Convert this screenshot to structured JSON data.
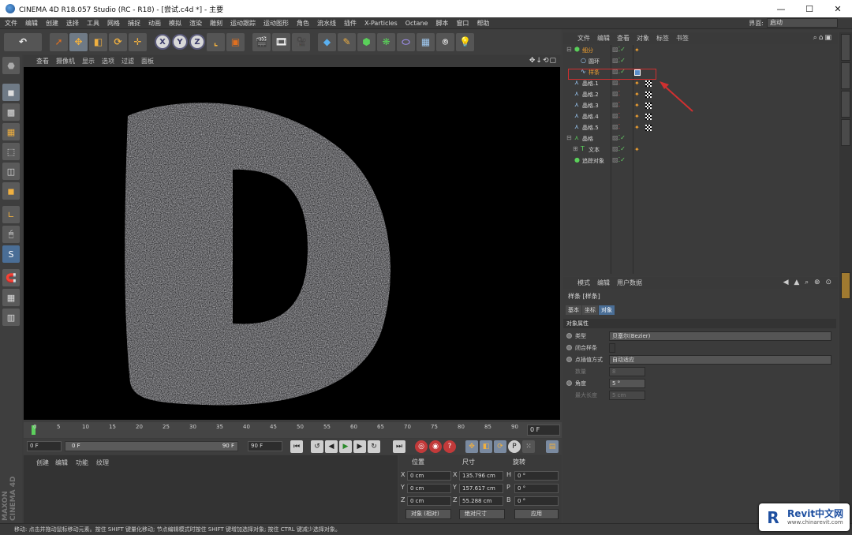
{
  "window": {
    "title": "CINEMA 4D R18.057 Studio (RC - R18) - [尝试.c4d *] - 主要",
    "min": "—",
    "max": "☐",
    "close": "✕"
  },
  "menu": {
    "items": [
      "文件",
      "编辑",
      "创建",
      "选择",
      "工具",
      "网格",
      "捕捉",
      "动画",
      "模拟",
      "渲染",
      "雕刻",
      "运动跟踪",
      "运动图形",
      "角色",
      "流水线",
      "插件",
      "X-Particles",
      "Octane",
      "脚本",
      "窗口",
      "帮助"
    ],
    "interface_label": "界面:",
    "interface_value": "启动"
  },
  "toolbar": {
    "undo": "↶",
    "axis": [
      "X",
      "Y",
      "Z"
    ]
  },
  "viewport": {
    "menu": [
      "查看",
      "摄像机",
      "显示",
      "选项",
      "过滤",
      "面板"
    ],
    "controls": "✥↓⟲▢"
  },
  "timeline": {
    "ticks": [
      "0",
      "5",
      "10",
      "15",
      "20",
      "25",
      "30",
      "35",
      "40",
      "45",
      "50",
      "55",
      "60",
      "65",
      "70",
      "75",
      "80",
      "85",
      "90"
    ],
    "frame_field": "0 F"
  },
  "transport": {
    "start": "0 F",
    "slider_start": "0 F",
    "slider_end": "90 F",
    "end": "90 F"
  },
  "material": {
    "menu": [
      "创建",
      "编辑",
      "功能",
      "纹理"
    ]
  },
  "coords": {
    "headers": [
      "位置",
      "尺寸",
      "旋转"
    ],
    "rows": [
      {
        "axis": "X",
        "pos": "0 cm",
        "size": "135.796 cm",
        "rlab": "H",
        "rot": "0 °"
      },
      {
        "axis": "Y",
        "pos": "0 cm",
        "size": "157.617 cm",
        "rlab": "P",
        "rot": "0 °"
      },
      {
        "axis": "Z",
        "pos": "0 cm",
        "size": "55.288 cm",
        "rlab": "B",
        "rot": "0 °"
      }
    ],
    "mode": "对象 (相对)",
    "size_mode": "绝对尺寸",
    "apply": "应用"
  },
  "status": "移动: 点击并拖动鼠标移动元素。按住 SHIFT 键量化移动; 节点编辑模式时按住 SHIFT 键增加选择对象; 按住 CTRL 键减少选择对象。",
  "maxon": "MAXON CINEMA 4D",
  "object_manager": {
    "menu": [
      "文件",
      "编辑",
      "查看",
      "对象",
      "标签",
      "书签"
    ],
    "objects": [
      {
        "name": "细分",
        "highlight": true
      },
      {
        "name": "圆环"
      },
      {
        "name": "样条",
        "highlight": true
      },
      {
        "name": "晶格.1"
      },
      {
        "name": "晶格.2"
      },
      {
        "name": "晶格.3"
      },
      {
        "name": "晶格.4"
      },
      {
        "name": "晶格.5"
      },
      {
        "name": "晶格"
      },
      {
        "name": "文本"
      },
      {
        "name": "追踪对象"
      }
    ]
  },
  "attributes": {
    "menu": [
      "模式",
      "编辑",
      "用户数据"
    ],
    "title": "样条 [样条]",
    "tabs": [
      "基本",
      "坐标",
      "对象"
    ],
    "section": "对象属性",
    "rows": [
      {
        "label": "类型",
        "value": "贝塞尔(Bezier)"
      },
      {
        "label": "闭合样条",
        "value": ""
      },
      {
        "label": "点插值方式",
        "value": "自动适应"
      },
      {
        "label": "数量",
        "value": "8"
      },
      {
        "label": "角度",
        "value": "5 °"
      },
      {
        "label": "最大长度",
        "value": "5 cm"
      }
    ]
  },
  "watermark": {
    "logo": "R",
    "name": "Revit中文网",
    "url": "www.chinarevit.com"
  }
}
